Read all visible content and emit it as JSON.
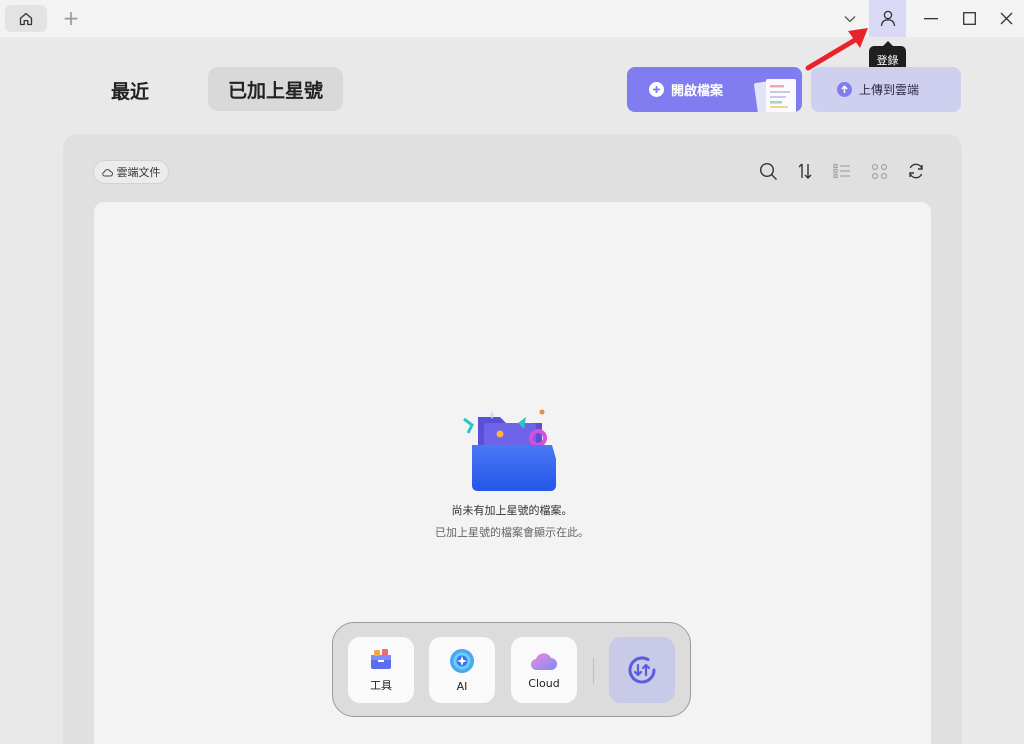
{
  "titlebar": {
    "tooltip_login": "登錄"
  },
  "header": {
    "tab_recent": "最近",
    "tab_starred": "已加上星號",
    "open_file_label": "開啟檔案",
    "upload_label": "上傳到雲端"
  },
  "panel": {
    "cloud_chip_label": "雲端文件"
  },
  "empty_state": {
    "title": "尚未有加上星號的檔案。",
    "subtitle": "已加上星號的檔案會顯示在此。"
  },
  "dock": {
    "tools_label": "工具",
    "ai_label": "AI",
    "cloud_label": "Cloud"
  },
  "colors": {
    "accent": "#7f7df0",
    "accent_light": "#cfcff0",
    "arrow": "#e8242a"
  }
}
